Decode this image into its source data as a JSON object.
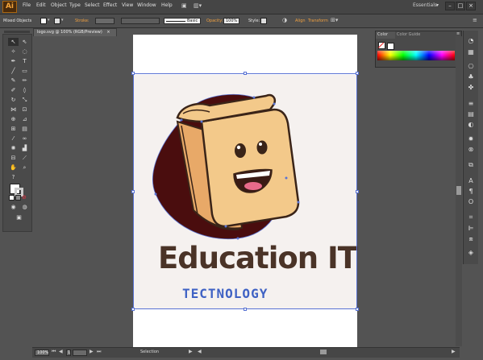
{
  "app": {
    "logo_text": "Ai",
    "menu": [
      "File",
      "Edit",
      "Object",
      "Type",
      "Select",
      "Effect",
      "View",
      "Window",
      "Help"
    ],
    "workspace": "Essentials",
    "window_buttons": [
      "–",
      "□",
      "×"
    ]
  },
  "control_bar": {
    "selection_label": "Mixed Objects",
    "stroke_label": "Stroke:",
    "brush_label": "Basic",
    "opacity_label": "Opacity:",
    "opacity_value": "100%",
    "style_label": "Style:",
    "align_label": "Align",
    "transform_label": "Transform"
  },
  "document": {
    "tab_title": "logo.svg @ 100% (RGB/Preview)",
    "close_icon": "×"
  },
  "color_panel": {
    "tabs": [
      "Color",
      "Color Guide"
    ],
    "menu_icon": "≡"
  },
  "artwork": {
    "title": "Education IT",
    "subtitle": "TECTNOLOGY",
    "colors": {
      "background": "#f5f1ef",
      "blob": "#4a0d0e",
      "paper": "#f3c98a",
      "paper_shade": "#e8a968",
      "outline": "#3a2418",
      "text": "#4a3327",
      "subtitle": "#3f62c4",
      "selection": "#5a73d3"
    }
  },
  "status_bar": {
    "zoom": "100%",
    "artboard_number": "1",
    "tool_label": "Selection"
  }
}
